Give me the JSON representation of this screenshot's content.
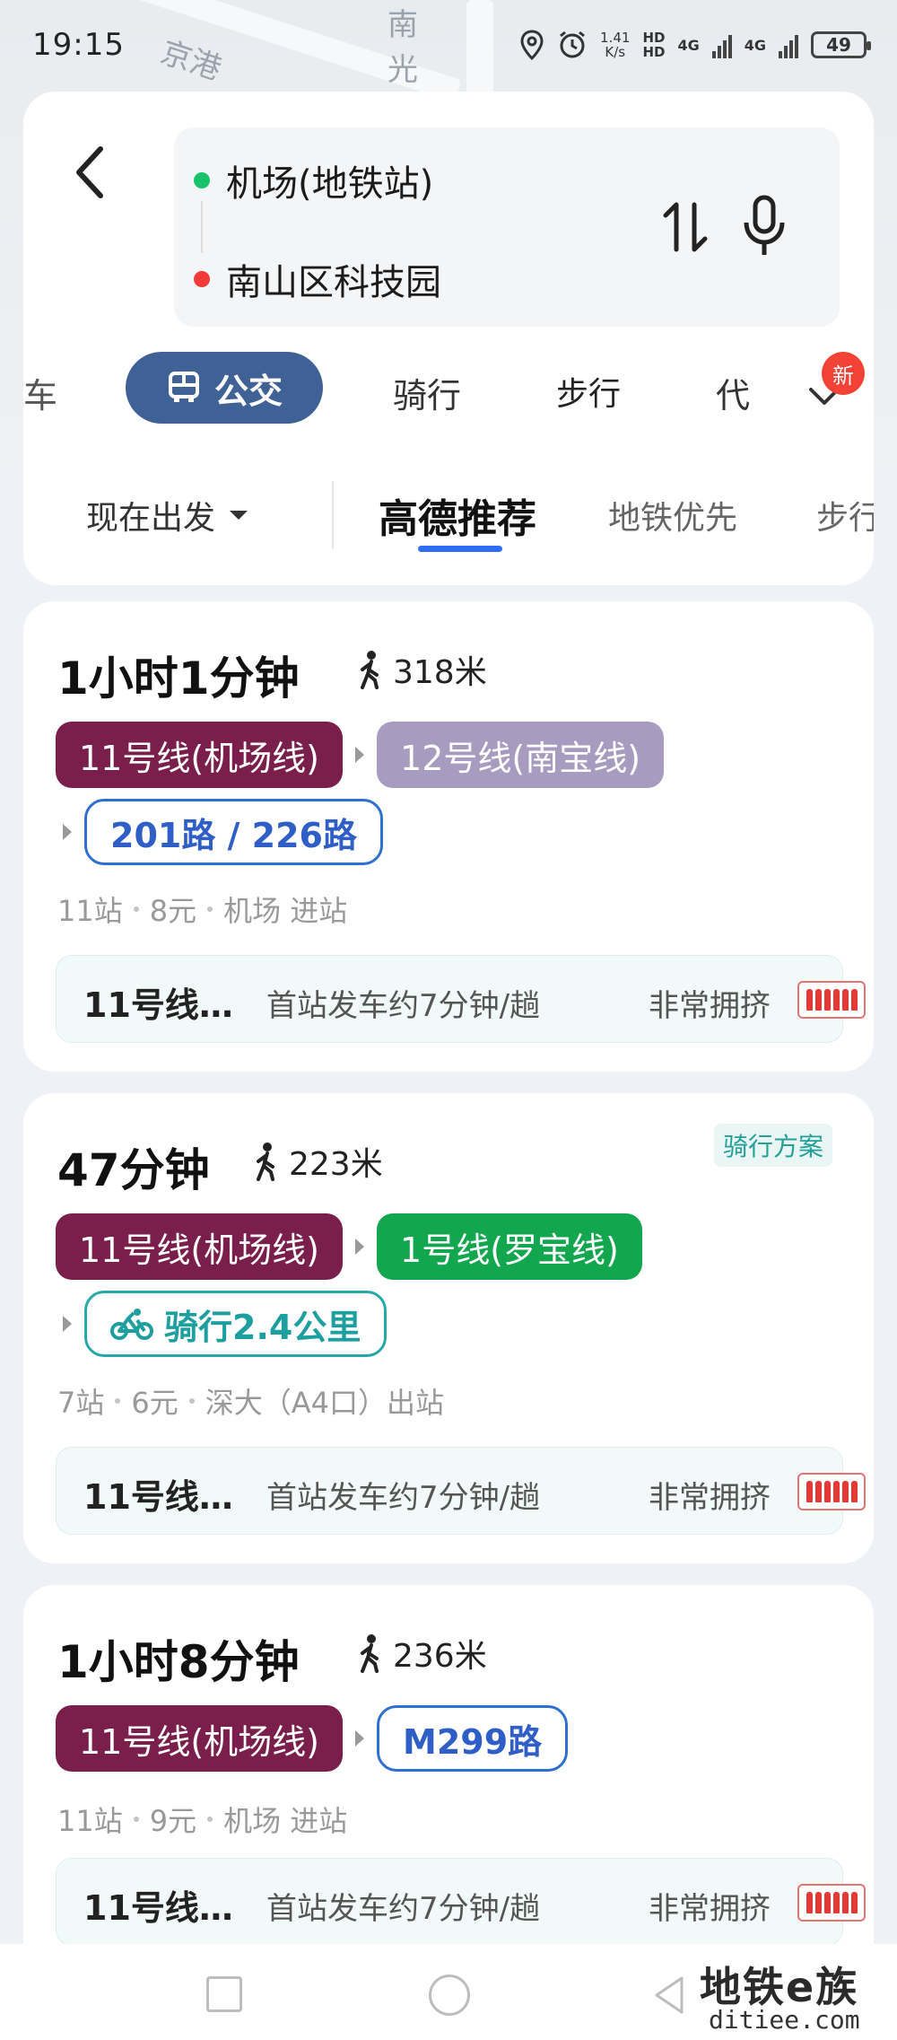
{
  "status_bar": {
    "time": "19:15",
    "speed_value": "1.41",
    "speed_unit": "K/s",
    "net1": "4G",
    "net2": "4G",
    "battery": "49"
  },
  "map_labels": [
    "京港",
    "南",
    "光"
  ],
  "search": {
    "from": "机场(地铁站)",
    "to": "南山区科技园"
  },
  "modes": {
    "cut_left": "车",
    "active": "公交",
    "ride": "骑行",
    "walk": "步行",
    "cut_right": "代",
    "new_badge": "新"
  },
  "filters": {
    "depart": "现在出发",
    "active": "高德推荐",
    "metro_first": "地铁优先",
    "walk_less": "步行"
  },
  "routes": [
    {
      "duration": "1小时1分钟",
      "walk": "318米",
      "lines": [
        {
          "label": "11号线(机场线)",
          "color": "#7a1f4b"
        },
        {
          "label": "12号线(南宝线)",
          "color": "#a79bbf"
        }
      ],
      "bus": "201路 / 226路",
      "meta": [
        "11站",
        "8元",
        "机场 进站"
      ],
      "info": {
        "line": "11号线…",
        "freq": "首站发车约7分钟/趟",
        "crowd": "非常拥挤"
      }
    },
    {
      "duration": "47分钟",
      "walk": "223米",
      "badge": "骑行方案",
      "lines": [
        {
          "label": "11号线(机场线)",
          "color": "#7a1f4b"
        },
        {
          "label": "1号线(罗宝线)",
          "color": "#12a64f"
        }
      ],
      "bike": "骑行2.4公里",
      "meta": [
        "7站",
        "6元",
        "深大（A4口）出站"
      ],
      "info": {
        "line": "11号线…",
        "freq": "首站发车约7分钟/趟",
        "crowd": "非常拥挤"
      }
    },
    {
      "duration": "1小时8分钟",
      "walk": "236米",
      "lines": [
        {
          "label": "11号线(机场线)",
          "color": "#7a1f4b"
        }
      ],
      "bus": "M299路",
      "meta": [
        "11站",
        "9元",
        "机场 进站"
      ],
      "info": {
        "line": "11号线…",
        "freq": "首站发车约7分钟/趟",
        "crowd": "非常拥挤"
      }
    }
  ],
  "watermark": {
    "top": "地铁e族",
    "bottom": "ditiee.com"
  }
}
